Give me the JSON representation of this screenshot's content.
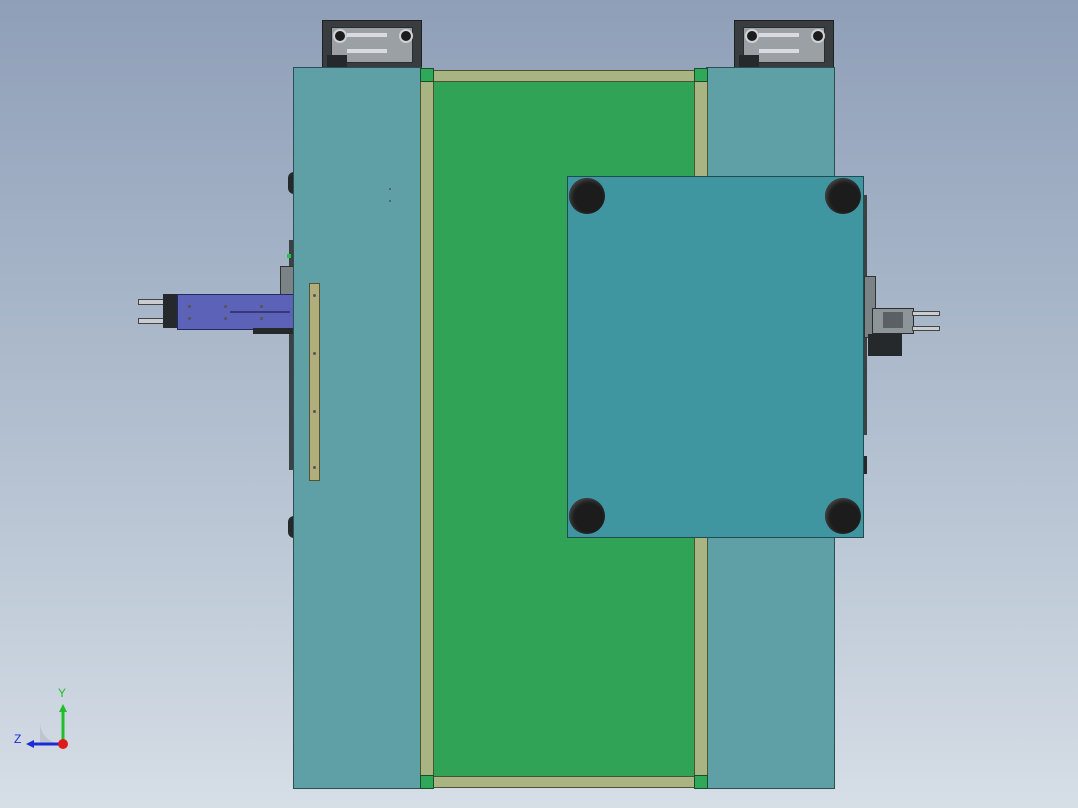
{
  "triad": {
    "y_label": "Y",
    "z_label": "Z",
    "colors": {
      "y": "#1fbf2a",
      "z": "#1c2bd8",
      "x": "#e01a1a"
    }
  },
  "colors": {
    "side_plate": "#5fa0a6",
    "conveyor_belt": "#31a356",
    "carrier_plate": "#3f95a0",
    "cylinder": "#5b62b8",
    "rail": "#a8b482"
  }
}
